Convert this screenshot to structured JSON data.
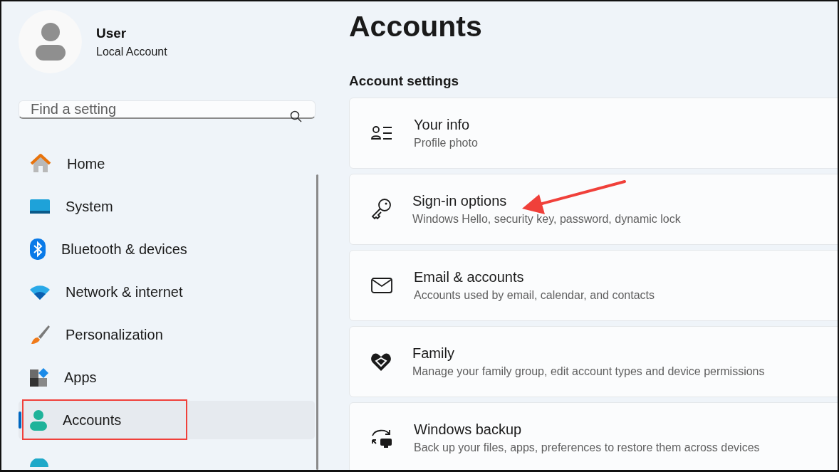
{
  "profile": {
    "name": "User",
    "account_type": "Local Account"
  },
  "search": {
    "placeholder": "Find a setting"
  },
  "nav": {
    "items": [
      {
        "label": "Home",
        "kind": "home",
        "selected": false,
        "highlighted": false
      },
      {
        "label": "System",
        "kind": "system",
        "selected": false,
        "highlighted": false
      },
      {
        "label": "Bluetooth & devices",
        "kind": "bluetooth",
        "selected": false,
        "highlighted": false
      },
      {
        "label": "Network & internet",
        "kind": "network",
        "selected": false,
        "highlighted": false
      },
      {
        "label": "Personalization",
        "kind": "brush",
        "selected": false,
        "highlighted": false
      },
      {
        "label": "Apps",
        "kind": "apps",
        "selected": false,
        "highlighted": false
      },
      {
        "label": "Accounts",
        "kind": "accounts",
        "selected": true,
        "highlighted": true
      },
      {
        "kind": "globe",
        "selected": false,
        "highlighted": false
      }
    ]
  },
  "page": {
    "title": "Accounts",
    "section": "Account settings",
    "cards": [
      {
        "title": "Your info",
        "subtitle": "Profile photo",
        "kind": "info",
        "pointed": false
      },
      {
        "title": "Sign-in options",
        "subtitle": "Windows Hello, security key, password, dynamic lock",
        "kind": "key",
        "pointed": true
      },
      {
        "title": "Email & accounts",
        "subtitle": "Accounts used by email, calendar, and contacts",
        "kind": "mail",
        "pointed": false
      },
      {
        "title": "Family",
        "subtitle": "Manage your family group, edit account types and device permissions",
        "kind": "family",
        "pointed": false
      },
      {
        "title": "Windows backup",
        "subtitle": "Back up your files, apps, preferences to restore them across devices",
        "kind": "backup",
        "pointed": false
      }
    ]
  }
}
